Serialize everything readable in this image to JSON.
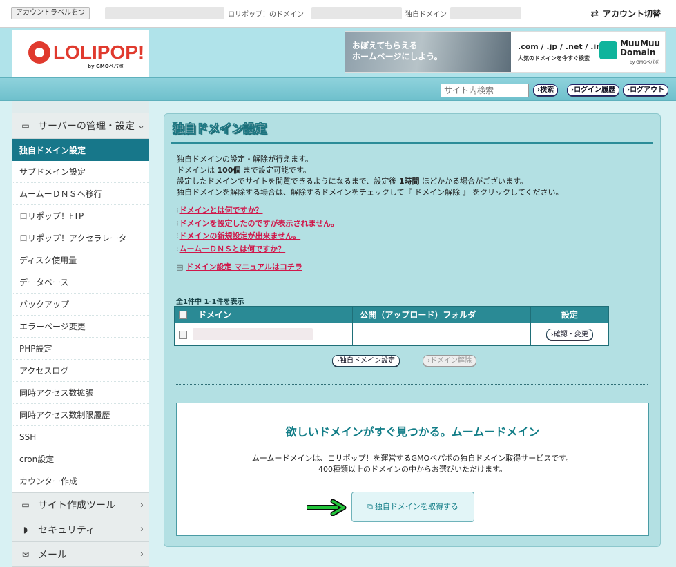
{
  "topbar": {
    "account_label": "アカウントラベルをつ",
    "lolipop_domain_label": "ロリポップ！のドメイン",
    "own_domain_label": "独自ドメイン",
    "switch_account": "アカウント切替"
  },
  "header": {
    "logo_text": "LOLIPOP!",
    "logo_sub": "by GMOペパボ",
    "banner_text": "おぼえてもらえる\nホームページにしよう。",
    "banner_domains": ".com / .jp / .net / .info",
    "banner_sub": "人気のドメインを今すぐ検索",
    "muumuu_name": "MuuMuu Domain",
    "muumuu_by": "by GMOペパボ"
  },
  "utilbar": {
    "search_placeholder": "サイト内検索",
    "search_button": "検索",
    "login_history": "ログイン履歴",
    "logout": "ログアウト"
  },
  "sidebar": {
    "category_server": "サーバーの管理・設定",
    "items": [
      "独自ドメイン設定",
      "サブドメイン設定",
      "ムームーＤＮＳへ移行",
      "ロリポップ！FTP",
      "ロリポップ！アクセラレータ",
      "ディスク使用量",
      "データベース",
      "バックアップ",
      "エラーページ変更",
      "PHP設定",
      "アクセスログ",
      "同時アクセス数拡張",
      "同時アクセス数制限履歴",
      "SSH",
      "cron設定",
      "カウンター作成"
    ],
    "category_site_tools": "サイト作成ツール",
    "category_security": "セキュリティ",
    "category_mail": "メール"
  },
  "main": {
    "title": "独自ドメイン設定",
    "desc_line1": "独自ドメインの設定・解除が行えます。",
    "desc_line2_pre": "ドメインは ",
    "desc_line2_bold": "100個",
    "desc_line2_post": " まで設定可能です。",
    "desc_line3_pre": "設定したドメインでサイトを閲覧できるようになるまで、設定後 ",
    "desc_line3_bold": "1時間",
    "desc_line3_post": " ほどかかる場合がございます。",
    "desc_line4": "独自ドメインを解除する場合は、解除するドメインをチェックして『 ドメイン解除 』 をクリックしてください。",
    "help_links": [
      "ドメインとは何ですか？",
      "ドメインを設定したのですが表示されません。",
      "ドメインの新規設定が出来ません。",
      "ムームーＤＮＳとは何ですか？"
    ],
    "manual_link": "ドメイン設定 マニュアルはコチラ",
    "count_text": "全1件中 1-1件を表示",
    "table_headers": [
      "ドメイン",
      "公開（アップロード）フォルダ",
      "設定"
    ],
    "row_button": "確認・変更",
    "add_button": "独自ドメイン設定",
    "remove_button": "ドメイン解除",
    "promo_title": "欲しいドメインがすぐ見つかる。ムームードメイン",
    "promo_line1": "ムームードメインは、ロリポップ！を運営するGMOペパボの独自ドメイン取得サービスです。",
    "promo_line2": "400種類以上のドメインの中からお選びいただけます。",
    "promo_button": "独自ドメインを取得する"
  },
  "colors": {
    "accent": "#17778a",
    "link": "#d0174a",
    "panel_bg": "#b3e0e3",
    "annotation_arrow": "#22c43a"
  }
}
